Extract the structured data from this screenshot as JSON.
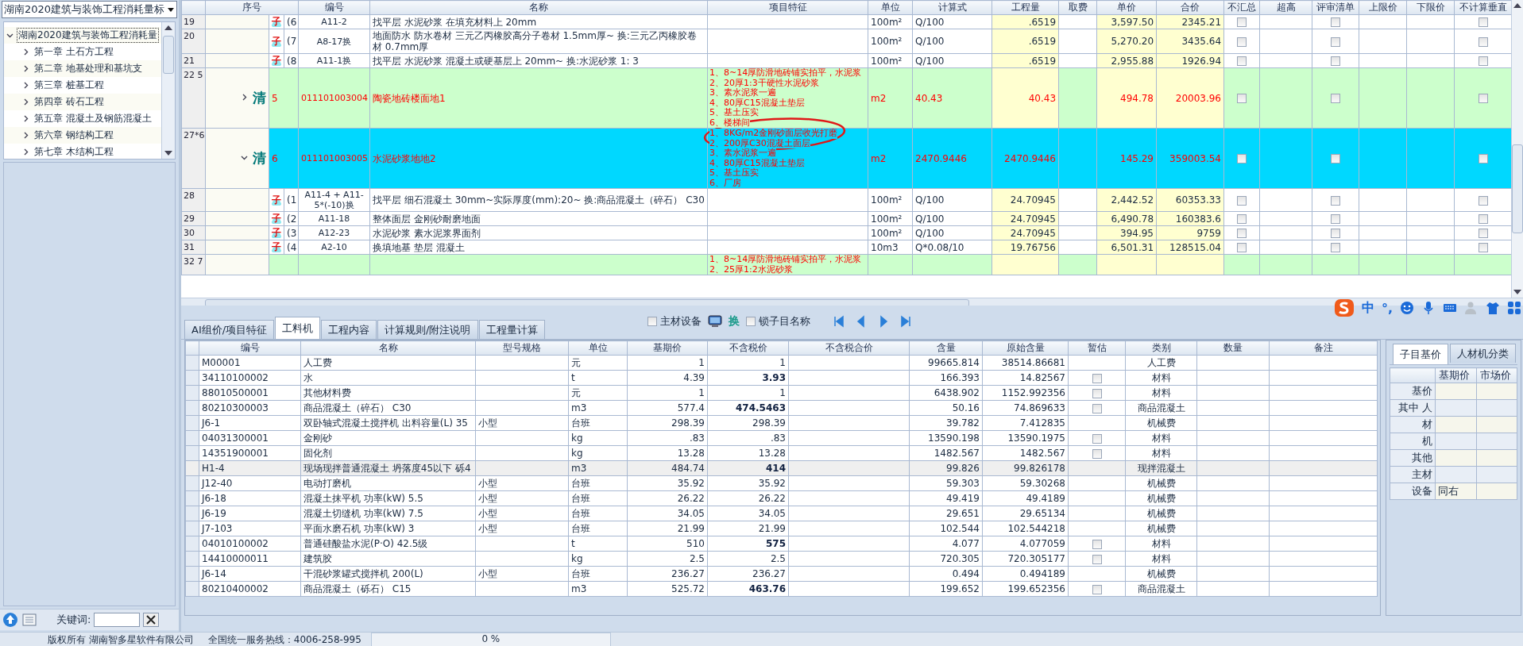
{
  "sidebar": {
    "dropdown": "湖南2020建筑与装饰工程消耗量标",
    "tree": [
      {
        "label": "湖南2020建筑与装饰工程消耗量",
        "expanded": true,
        "selected": true,
        "children": [
          {
            "label": "第一章 土石方工程",
            "expanded": false,
            "selected": false
          },
          {
            "label": "第二章 地基处理和基坑支",
            "expanded": false,
            "selected": false
          },
          {
            "label": "第三章 桩基工程",
            "expanded": false,
            "selected": false
          },
          {
            "label": "第四章 砖石工程",
            "expanded": false,
            "selected": false
          },
          {
            "label": "第五章 混凝土及钢筋混凝土",
            "expanded": false,
            "selected": false
          },
          {
            "label": "第六章 钢结构工程",
            "expanded": false,
            "selected": false
          },
          {
            "label": "第七章 木结构工程",
            "expanded": false,
            "selected": false
          }
        ]
      }
    ],
    "keyword": {
      "label": "关键词:"
    }
  },
  "grid": {
    "columns": [
      "序号",
      "编号",
      "名称",
      "项目特征",
      "单位",
      "计算式",
      "工程量",
      "取费",
      "单价",
      "合价",
      "不汇总",
      "超高",
      "评审清单",
      "上限价",
      "下限价",
      "不计算垂直"
    ],
    "rows": [
      {
        "row": "19",
        "kind": "sub",
        "selected": false,
        "badge": "子",
        "seq": "(6",
        "code": "A11-2",
        "name": "找平层 水泥砂浆 在填充材料上 20mm",
        "unit": "100m²",
        "formula": "Q/100",
        "qty": ".6519",
        "price": "3,597.50",
        "total": "2345.21",
        "no_sum": false,
        "review": false,
        "no_vertical": false
      },
      {
        "row": "20",
        "kind": "sub",
        "selected": false,
        "badge": "子",
        "seq": "(7",
        "code": "A8-17换",
        "name": "地面防水 防水卷材 三元乙丙橡胶高分子卷材 1.5mm厚~ 换:三元乙丙橡胶卷材 0.7mm厚",
        "unit": "100m²",
        "formula": "Q/100",
        "qty": ".6519",
        "price": "5,270.20",
        "total": "3435.64",
        "no_sum": false,
        "review": false,
        "no_vertical": false
      },
      {
        "row": "21",
        "kind": "sub",
        "selected": false,
        "badge": "子",
        "seq": "(8",
        "code": "A11-1换",
        "name": "找平层 水泥砂浆 混凝土或硬基层上 20mm~ 换:水泥砂浆 1: 3",
        "unit": "100m²",
        "formula": "Q/100",
        "qty": ".6519",
        "price": "2,955.88",
        "total": "1926.94",
        "no_sum": false,
        "review": false,
        "no_vertical": false
      },
      {
        "row": "22 5",
        "kind": "list",
        "selected": false,
        "expanded": false,
        "badge": "清",
        "seq": "5",
        "code": "011101003004",
        "name": "陶瓷地砖楼面地1",
        "features": [
          "1、8~14厚防滑地砖铺实拍平，水泥浆",
          "2、20厚1:3干硬性水泥砂浆",
          "3、素水泥浆一遍",
          "4、80厚C15混凝土垫层",
          "5、基土压实",
          "6、楼梯间"
        ],
        "unit": "m2",
        "formula": "40.43",
        "qty": "40.43",
        "price": "494.78",
        "total": "20003.96",
        "no_sum": false,
        "review": false,
        "no_vertical": false
      },
      {
        "row": "27*6",
        "kind": "list",
        "selected": true,
        "expanded": true,
        "badge": "清",
        "seq": "6",
        "code": "011101003005",
        "name": "水泥砂浆地地2",
        "features": [
          "1、8KG/m2金刚砂面层收光打磨",
          "2、200厚C30混凝土面层",
          "3、素水泥浆一遍",
          "4、80厚C15混凝土垫层",
          "5、基土压实",
          "6、厂房"
        ],
        "unit": "m2",
        "formula": "2470.9446",
        "qty": "2470.9446",
        "price": "145.29",
        "total": "359003.54",
        "no_sum": false,
        "review": false,
        "no_vertical": false
      },
      {
        "row": "28",
        "kind": "sub",
        "selected": false,
        "badge": "子",
        "seq": "(1",
        "code": "A11-4 + A11-5*(-10)换",
        "name": "找平层 细石混凝土 30mm~实际厚度(mm):20~ 换:商品混凝土（碎石） C30",
        "unit": "100m²",
        "formula": "Q/100",
        "qty": "24.70945",
        "price": "2,442.52",
        "total": "60353.33",
        "no_sum": false,
        "review": false,
        "no_vertical": false
      },
      {
        "row": "29",
        "kind": "sub",
        "selected": false,
        "badge": "子",
        "seq": "(2",
        "code": "A11-18",
        "name": "整体面层 金刚砂耐磨地面",
        "unit": "100m²",
        "formula": "Q/100",
        "qty": "24.70945",
        "price": "6,490.78",
        "total": "160383.6",
        "no_sum": false,
        "review": false,
        "no_vertical": false
      },
      {
        "row": "30",
        "kind": "sub",
        "selected": false,
        "badge": "子",
        "seq": "(3",
        "code": "A12-23",
        "name": "水泥砂浆 素水泥浆界面剂",
        "unit": "100m²",
        "formula": "Q/100",
        "qty": "24.70945",
        "price": "394.95",
        "total": "9759",
        "no_sum": false,
        "review": false,
        "no_vertical": false
      },
      {
        "row": "31",
        "kind": "sub",
        "selected": false,
        "badge": "子",
        "seq": "(4",
        "code": "A2-10",
        "name": "换填地基 垫层 混凝土",
        "unit": "10m3",
        "formula": "Q*0.08/10",
        "qty": "19.76756",
        "price": "6,501.31",
        "total": "128515.04",
        "no_sum": false,
        "review": false,
        "no_vertical": false
      },
      {
        "row": "32 7",
        "kind": "list",
        "selected": false,
        "features": [
          "1、8~14厚防滑地砖铺实拍平，水泥浆",
          "2、25厚1:2水泥砂浆"
        ]
      }
    ],
    "annotations": [
      {
        "kind": "ellipse"
      }
    ]
  },
  "detail": {
    "tabs": [
      {
        "label": "AI组价/项目特征",
        "selected": false
      },
      {
        "label": "工料机",
        "selected": true
      },
      {
        "label": "工程内容",
        "selected": false
      },
      {
        "label": "计算规则/附注说明",
        "selected": false
      },
      {
        "label": "工程量计算",
        "selected": false
      }
    ],
    "toolbar": {
      "main_material": {
        "label": "主材设备",
        "checked": false
      },
      "replace": "换",
      "lock": {
        "label": "锁子目名称",
        "checked": false
      }
    },
    "table": {
      "columns": [
        "编号",
        "名称",
        "型号规格",
        "单位",
        "基期价",
        "不含税价",
        "不含税合价",
        "含量",
        "原始含量",
        "暂估",
        "类别",
        "数量",
        "备注"
      ],
      "rows": [
        {
          "code": "M00001",
          "name": "人工费",
          "unit": "元",
          "base": "1",
          "notax": "1",
          "notax_changed": false,
          "content": "99665.814",
          "orig": "38514.86681",
          "category": "人工费",
          "selected": false
        },
        {
          "code": "34110100002",
          "name": "水",
          "unit": "t",
          "base": "4.39",
          "notax": "3.93",
          "notax_changed": true,
          "content": "166.393",
          "orig": "14.82567",
          "provisional": false,
          "category": "材料",
          "selected": false
        },
        {
          "code": "88010500001",
          "name": "其他材料费",
          "unit": "元",
          "base": "1",
          "notax": "1",
          "notax_changed": false,
          "content": "6438.902",
          "orig": "1152.992356",
          "provisional": false,
          "category": "材料",
          "selected": false
        },
        {
          "code": "80210300003",
          "name": "商品混凝土（碎石） C30",
          "unit": "m3",
          "base": "577.4",
          "notax": "474.5463",
          "notax_changed": true,
          "content": "50.16",
          "orig": "74.869633",
          "provisional": false,
          "category": "商品混凝土",
          "selected": false
        },
        {
          "code": "J6-1",
          "name": "双卧轴式混凝土搅拌机 出料容量(L) 35",
          "spec": "小型",
          "unit": "台班",
          "base": "298.39",
          "notax": "298.39",
          "notax_changed": false,
          "content": "39.782",
          "orig": "7.412835",
          "category": "机械费",
          "selected": false
        },
        {
          "code": "04031300001",
          "name": "金刚砂",
          "unit": "kg",
          "base": ".83",
          "notax": ".83",
          "notax_changed": false,
          "content": "13590.198",
          "orig": "13590.1975",
          "provisional": false,
          "category": "材料",
          "selected": false
        },
        {
          "code": "14351900001",
          "name": "固化剂",
          "unit": "kg",
          "base": "13.28",
          "notax": "13.28",
          "notax_changed": false,
          "content": "1482.567",
          "orig": "1482.567",
          "provisional": false,
          "category": "材料",
          "selected": false
        },
        {
          "code": "H1-4",
          "name": "现场现拌普通混凝土 坍落度45以下 砾4",
          "unit": "m3",
          "base": "484.74",
          "notax": "414",
          "notax_changed": true,
          "content": "99.826",
          "orig": "99.826178",
          "category": "现拌混凝土",
          "selected": true
        },
        {
          "code": "J12-40",
          "name": "电动打磨机",
          "spec": "小型",
          "unit": "台班",
          "base": "35.92",
          "notax": "35.92",
          "notax_changed": false,
          "content": "59.303",
          "orig": "59.30268",
          "category": "机械费",
          "selected": false
        },
        {
          "code": "J6-18",
          "name": "混凝土抹平机 功率(kW) 5.5",
          "spec": "小型",
          "unit": "台班",
          "base": "26.22",
          "notax": "26.22",
          "notax_changed": false,
          "content": "49.419",
          "orig": "49.4189",
          "category": "机械费",
          "selected": false
        },
        {
          "code": "J6-19",
          "name": "混凝土切缝机 功率(kW) 7.5",
          "spec": "小型",
          "unit": "台班",
          "base": "34.05",
          "notax": "34.05",
          "notax_changed": false,
          "content": "29.651",
          "orig": "29.65134",
          "category": "机械费",
          "selected": false
        },
        {
          "code": "J7-103",
          "name": "平面水磨石机 功率(kW) 3",
          "spec": "小型",
          "unit": "台班",
          "base": "21.99",
          "notax": "21.99",
          "notax_changed": false,
          "content": "102.544",
          "orig": "102.544218",
          "category": "机械费",
          "selected": false
        },
        {
          "code": "04010100002",
          "name": "普通硅酸盐水泥(P·O) 42.5级",
          "unit": "t",
          "base": "510",
          "notax": "575",
          "notax_changed": true,
          "content": "4.077",
          "orig": "4.077059",
          "provisional": false,
          "category": "材料",
          "selected": false
        },
        {
          "code": "14410000011",
          "name": "建筑胶",
          "unit": "kg",
          "base": "2.5",
          "notax": "2.5",
          "notax_changed": false,
          "content": "720.305",
          "orig": "720.305177",
          "provisional": false,
          "category": "材料",
          "selected": false
        },
        {
          "code": "J6-14",
          "name": "干混砂浆罐式搅拌机 200(L)",
          "spec": "小型",
          "unit": "台班",
          "base": "236.27",
          "notax": "236.27",
          "notax_changed": false,
          "content": "0.494",
          "orig": "0.494189",
          "category": "机械费",
          "selected": false
        },
        {
          "code": "80210400002",
          "name": "商品混凝土（砾石） C15",
          "unit": "m3",
          "base": "525.72",
          "notax": "463.76",
          "notax_changed": true,
          "content": "199.652",
          "orig": "199.652356",
          "provisional": false,
          "category": "商品混凝土",
          "selected": false
        }
      ]
    },
    "side": {
      "tabs": [
        {
          "label": "子目基价",
          "selected": true
        },
        {
          "label": "人材机分类",
          "selected": false
        }
      ],
      "columns": [
        "基期价",
        "市场价"
      ],
      "rows": [
        {
          "label": "基价"
        },
        {
          "label": "其中 人"
        },
        {
          "label": "材"
        },
        {
          "label": "机"
        },
        {
          "label": "其他"
        },
        {
          "label": "主材"
        },
        {
          "label": "设备",
          "base": "同右"
        }
      ]
    }
  },
  "ime": {
    "mode": "中",
    "punct": "°,"
  },
  "status_bar": {
    "copyright": "版权所有 湖南智多星软件有限公司",
    "hotline": "全国统一服务热线：4006-258-995",
    "progress": {
      "text": "0 %",
      "level": 0
    }
  }
}
